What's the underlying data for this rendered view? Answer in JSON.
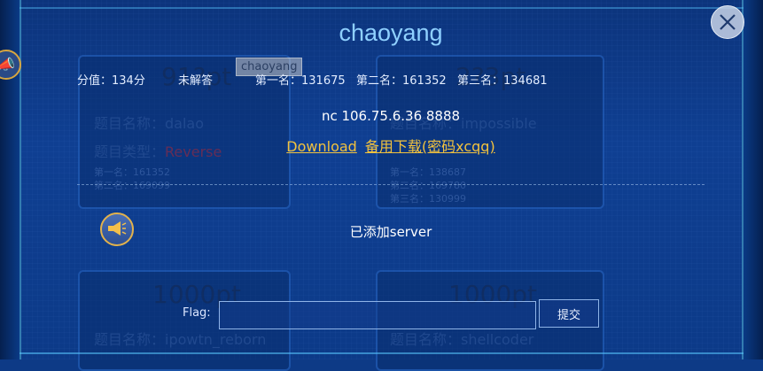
{
  "background": {
    "cards": [
      {
        "points": "91?pt",
        "name_label": "题目名称：dalao",
        "type_label": "题目类型：",
        "type_value": "Reverse",
        "rank1": "第一名：161352",
        "rank2": "第二名：169099"
      },
      {
        "points": "2?3pt",
        "name_label": "题目名称：impossible",
        "rank1": "第一名：138687",
        "rank2": "第二名：169780",
        "rank3": "第三名：130999"
      },
      {
        "points": "1000pt",
        "name_label": "题目名称：ipowtn_reborn"
      },
      {
        "points": "1000pt",
        "name_label": "题目名称：shellcoder"
      }
    ]
  },
  "modal": {
    "title": "chaoyang",
    "tooltip": "chaoyang",
    "score": "分值：134分",
    "status": "未解答",
    "first": "第一名：131675",
    "second": "第二名：161352",
    "third": "第三名：134681",
    "connection": "nc 106.75.6.36 8888",
    "download_label": "Download",
    "backup_label": "备用下载(密码xcqq)",
    "notice": "已添加server",
    "flag_label": "Flag:",
    "flag_value": "",
    "submit_label": "提交"
  },
  "colors": {
    "title": "#8fd0ff",
    "link": "#f2c23e",
    "background": "#0d3a86"
  },
  "icons": {
    "close": "close-icon",
    "speaker": "speaker-icon"
  }
}
